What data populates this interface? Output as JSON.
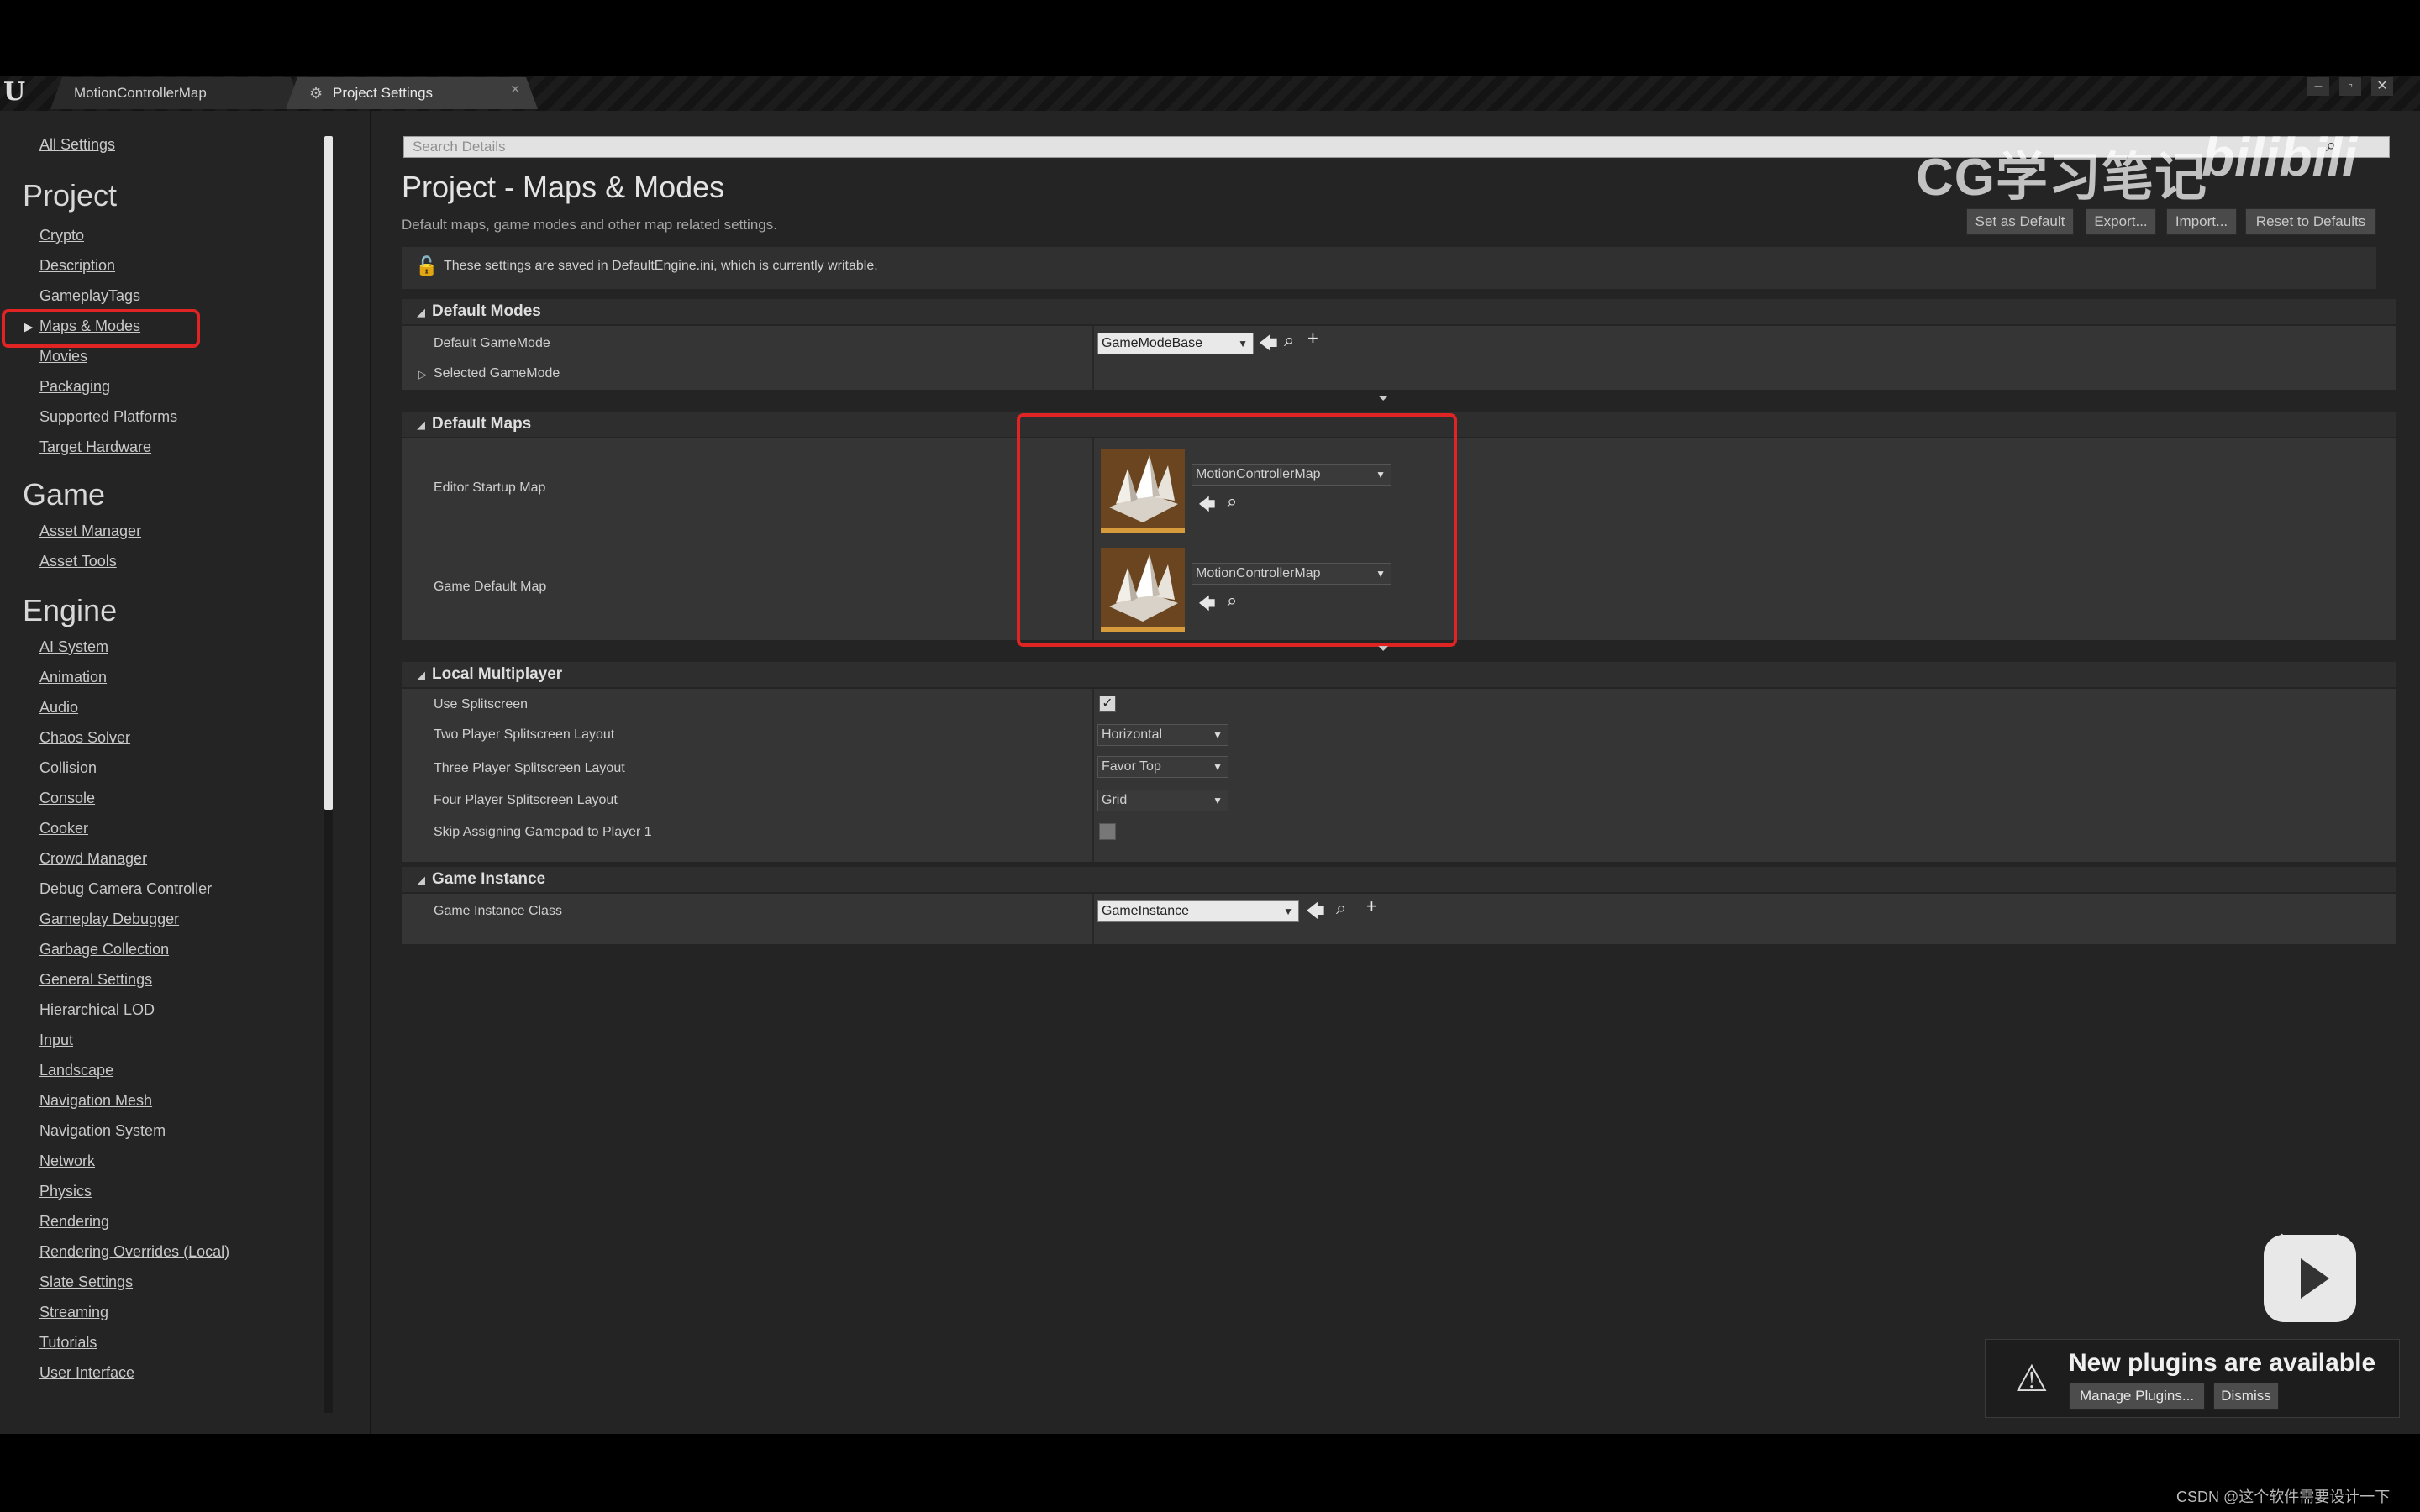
{
  "tabs": [
    {
      "label": "MotionControllerMap"
    },
    {
      "label": "Project Settings"
    }
  ],
  "window_controls": [
    "–",
    "▫",
    "✕"
  ],
  "sidebar": {
    "all_settings": "All Settings",
    "sections": [
      {
        "title": "Project",
        "items": [
          "Crypto",
          "Description",
          "GameplayTags",
          "Maps & Modes",
          "Movies",
          "Packaging",
          "Supported Platforms",
          "Target Hardware"
        ]
      },
      {
        "title": "Game",
        "items": [
          "Asset Manager",
          "Asset Tools"
        ]
      },
      {
        "title": "Engine",
        "items": [
          "AI System",
          "Animation",
          "Audio",
          "Chaos Solver",
          "Collision",
          "Console",
          "Cooker",
          "Crowd Manager",
          "Debug Camera Controller",
          "Gameplay Debugger",
          "Garbage Collection",
          "General Settings",
          "Hierarchical LOD",
          "Input",
          "Landscape",
          "Navigation Mesh",
          "Navigation System",
          "Network",
          "Physics",
          "Rendering",
          "Rendering Overrides (Local)",
          "Slate Settings",
          "Streaming",
          "Tutorials",
          "User Interface"
        ]
      }
    ],
    "selected": "Maps & Modes"
  },
  "details": {
    "search_placeholder": "Search Details",
    "title": "Project - Maps & Modes",
    "subtitle": "Default maps, game modes and other map related settings.",
    "buttons": {
      "set_default": "Set as Default",
      "export": "Export...",
      "import": "Import...",
      "reset": "Reset to Defaults"
    },
    "notice": "These settings are saved in DefaultEngine.ini, which is currently writable."
  },
  "default_modes": {
    "title": "Default Modes",
    "default_gamemode_label": "Default GameMode",
    "default_gamemode_value": "GameModeBase",
    "selected_gamemode_label": "Selected GameMode"
  },
  "default_maps": {
    "title": "Default Maps",
    "editor_startup_label": "Editor Startup Map",
    "editor_startup_value": "MotionControllerMap",
    "game_default_label": "Game Default Map",
    "game_default_value": "MotionControllerMap"
  },
  "local_multiplayer": {
    "title": "Local Multiplayer",
    "use_splitscreen_label": "Use Splitscreen",
    "use_splitscreen_checked": true,
    "two_player_label": "Two Player Splitscreen Layout",
    "two_player_value": "Horizontal",
    "three_player_label": "Three Player Splitscreen Layout",
    "three_player_value": "Favor Top",
    "four_player_label": "Four Player Splitscreen Layout",
    "four_player_value": "Grid",
    "skip_gamepad_label": "Skip Assigning Gamepad to Player 1",
    "skip_gamepad_checked": false
  },
  "game_instance": {
    "title": "Game Instance",
    "class_label": "Game Instance Class",
    "class_value": "GameInstance"
  },
  "watermark": {
    "text": "CG学习笔记",
    "brand": "bilibili"
  },
  "toast": {
    "title": "New plugins are available",
    "manage": "Manage Plugins...",
    "dismiss": "Dismiss"
  },
  "footer_credit": "CSDN @这个软件需要设计一下",
  "colors": {
    "highlight_box": "#e02424",
    "panel_bg": "#242424",
    "map_thumb_accent": "#d89b3b"
  }
}
